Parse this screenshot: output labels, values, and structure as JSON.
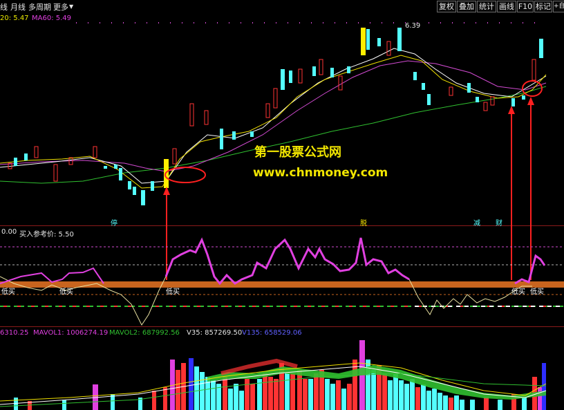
{
  "menu": {
    "item0": "线",
    "item1": "月线",
    "item2": "多周期",
    "item3": "更多"
  },
  "right_buttons": [
    "复权",
    "叠加",
    "统计",
    "画线",
    "F10",
    "标记",
    "+自"
  ],
  "main": {
    "ma20": "20: 5.47",
    "ma60": "MA60: 5.49",
    "peak_price": "6.39",
    "watermark_title": "第一股票公式网",
    "watermark_url": "www.chnmoney.com",
    "tags": [
      "停",
      "脱",
      "减",
      "财"
    ]
  },
  "indicator": {
    "value": "0.00",
    "buy_ref": "买入参考价: 5.50",
    "signals": [
      "低买",
      "低买",
      "低买",
      "低买",
      "低买"
    ]
  },
  "volume": {
    "vol": "6310.25",
    "mavol1": "MAVOL1: 1006274.19",
    "mavol2": "MAVOL2: 687992.56",
    "v35": "V35: 857269.50",
    "v135": "V135: 658529.06"
  },
  "colors": {
    "up": "#ff3333",
    "down": "#54ffff",
    "ma_white": "#ffffff",
    "ma_yellow": "#f0e000",
    "ma_purple": "#d24bd2",
    "ma_green": "#30c030",
    "signal": "#c8641e"
  }
}
